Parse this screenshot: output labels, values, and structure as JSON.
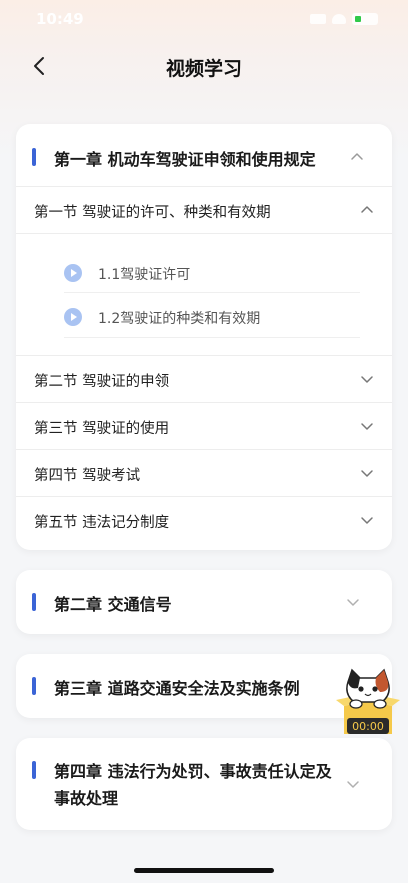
{
  "status_bar": {
    "time": "10:49"
  },
  "nav": {
    "title": "视频学习"
  },
  "chapters": [
    {
      "title": "第一章 机动车驾驶证申领和使用规定",
      "expanded": true,
      "sections": [
        {
          "title": "第一节 驾驶证的许可、种类和有效期",
          "expanded": true,
          "lessons": [
            {
              "label": "1.1驾驶证许可"
            },
            {
              "label": "1.2驾驶证的种类和有效期"
            }
          ]
        },
        {
          "title": "第二节 驾驶证的申领",
          "expanded": false
        },
        {
          "title": "第三节 驾驶证的使用",
          "expanded": false
        },
        {
          "title": "第四节 驾驶考试",
          "expanded": false
        },
        {
          "title": "第五节 违法记分制度",
          "expanded": false
        }
      ]
    },
    {
      "title": "第二章 交通信号",
      "expanded": false
    },
    {
      "title": "第三章 道路交通安全法及实施条例",
      "expanded": false
    },
    {
      "title": "第四章 违法行为处罚、事故责任认定及事故处理",
      "expanded": false
    }
  ],
  "floating_timer": {
    "time": "00:00",
    "icon": "cat-mascot-icon"
  },
  "colors": {
    "accent": "#3b64d6",
    "play": "#a9c3f2",
    "timer_bg": "#f5c94a"
  }
}
